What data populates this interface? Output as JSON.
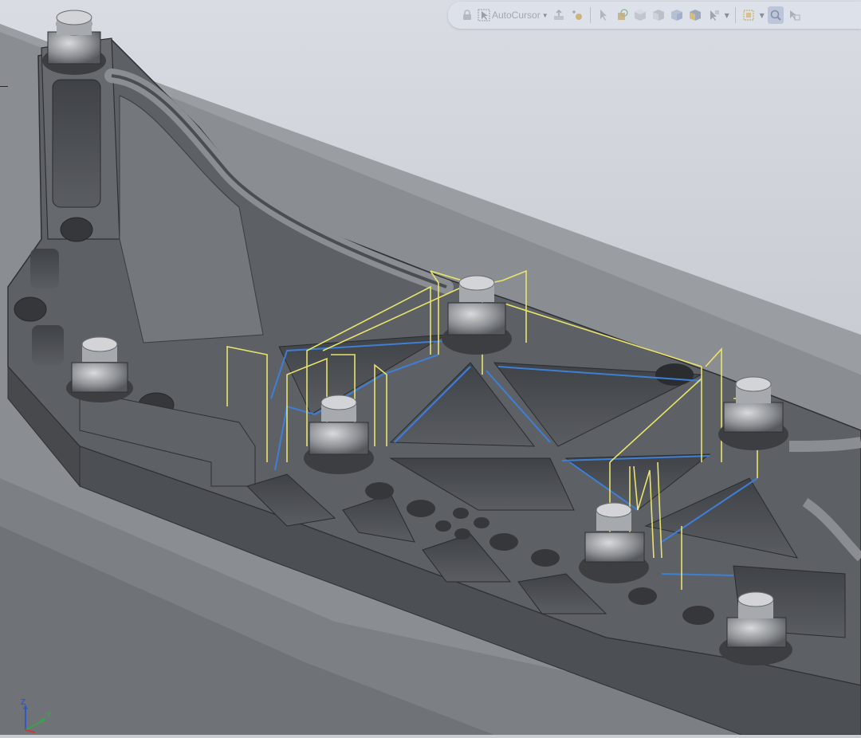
{
  "toolbar": {
    "autocursor_label": "AutoCursor",
    "buttons": [
      "lock-icon",
      "select-cursor-icon",
      "pan-icon",
      "zoom-icon",
      "pointer-icon",
      "rotate-icon",
      "view-front-icon",
      "view-top-icon",
      "view-iso-icon",
      "display-style-icon",
      "hide-show-icon",
      "section-view-icon",
      "magnify-icon",
      "view-settings-icon"
    ]
  },
  "triad": {
    "z_label": "Z",
    "y_label": "Y"
  },
  "colors": {
    "background_top": "#d7dbe2",
    "background_bottom": "#b8bcc2",
    "part_dark": "#505459",
    "part_mid": "#6b6f74",
    "part_light": "#8b8f94",
    "fixture": "#85898d",
    "toolpath_yellow": "#e9e36a",
    "toolpath_blue": "#3e7fd6"
  }
}
